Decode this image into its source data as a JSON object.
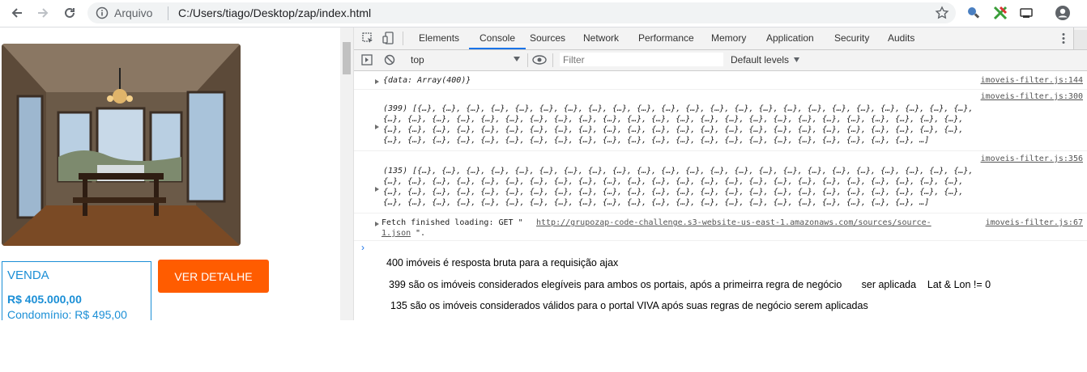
{
  "browser": {
    "omnibox_label": "Arquivo",
    "url": "C:/Users/tiago/Desktop/zap/index.html"
  },
  "card": {
    "type": "VENDA",
    "price": "R$ 405.000,00",
    "condo": "Condomínio: R$ 495,00",
    "detail_button": "VER DETALHE"
  },
  "devtools": {
    "tabs": [
      "Elements",
      "Console",
      "Sources",
      "Network",
      "Performance",
      "Memory",
      "Application",
      "Security",
      "Audits"
    ],
    "active_tab": "Console",
    "context": "top",
    "filter_placeholder": "Filter",
    "levels": "Default levels",
    "messages": [
      {
        "text": "{data: Array(400)}",
        "source": "imoveis-filter.js:144"
      },
      {
        "source": "imoveis-filter.js:300",
        "lines": [
          "(399) [{…}, {…}, {…}, {…}, {…}, {…}, {…}, {…}, {…}, {…}, {…}, {…}, {…}, {…}, {…}, {…}, {…}, {…}, {…}, {…}, {…}, {…}, {…},",
          "{…}, {…}, {…}, {…}, {…}, {…}, {…}, {…}, {…}, {…}, {…}, {…}, {…}, {…}, {…}, {…}, {…}, {…}, {…}, {…}, {…}, {…}, {…}, {…},",
          "{…}, {…}, {…}, {…}, {…}, {…}, {…}, {…}, {…}, {…}, {…}, {…}, {…}, {…}, {…}, {…}, {…}, {…}, {…}, {…}, {…}, {…}, {…}, {…},",
          "{…}, {…}, {…}, {…}, {…}, {…}, {…}, {…}, {…}, {…}, {…}, {…}, {…}, {…}, {…}, {…}, {…}, {…}, {…}, {…}, {…}, {…}, …]"
        ]
      },
      {
        "source": "imoveis-filter.js:356",
        "lines": [
          "(135) [{…}, {…}, {…}, {…}, {…}, {…}, {…}, {…}, {…}, {…}, {…}, {…}, {…}, {…}, {…}, {…}, {…}, {…}, {…}, {…}, {…}, {…}, {…},",
          "{…}, {…}, {…}, {…}, {…}, {…}, {…}, {…}, {…}, {…}, {…}, {…}, {…}, {…}, {…}, {…}, {…}, {…}, {…}, {…}, {…}, {…}, {…}, {…},",
          "{…}, {…}, {…}, {…}, {…}, {…}, {…}, {…}, {…}, {…}, {…}, {…}, {…}, {…}, {…}, {…}, {…}, {…}, {…}, {…}, {…}, {…}, {…}, {…},",
          "{…}, {…}, {…}, {…}, {…}, {…}, {…}, {…}, {…}, {…}, {…}, {…}, {…}, {…}, {…}, {…}, {…}, {…}, {…}, {…}, {…}, {…}, …]"
        ]
      },
      {
        "text_prefix": "Fetch finished loading: GET \"",
        "url_part1": "http://grupozap-code-challenge.s3-website-us-east-1.amazonaws.com/sources/source-",
        "url_part2": "1.json",
        "text_suffix": "\".",
        "source": "imoveis-filter.js:67"
      }
    ],
    "prompt": "›"
  },
  "notes": [
    "400 imóveis é resposta bruta para a requisição ajax",
    "399 são os imóveis considerados elegíveis para ambos os portais, após a primeirra regra de negócio       ser aplicada    Lat & Lon != 0",
    "135 são os imóveis considerados válidos para o portal VIVA após suas regras de negócio serem aplicadas"
  ]
}
